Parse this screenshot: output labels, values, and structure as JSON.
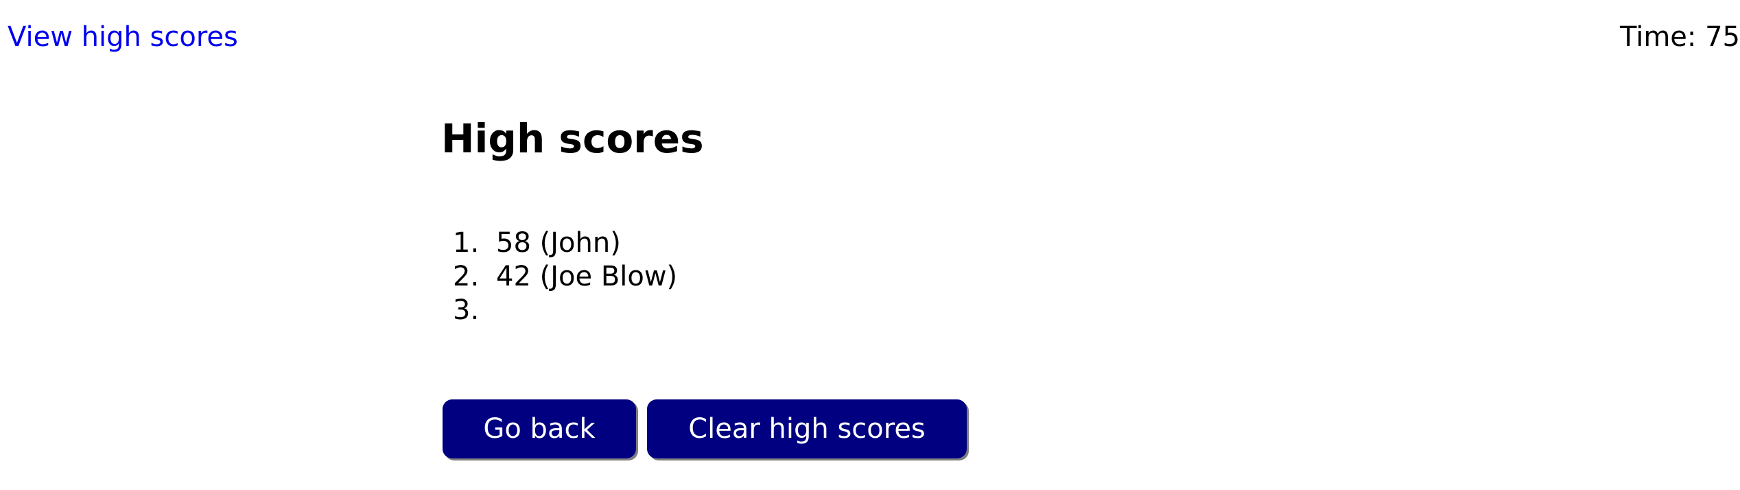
{
  "header": {
    "view_high_scores_link": "View high scores",
    "timer_text": "Time: 75"
  },
  "main": {
    "title": "High scores",
    "scores": [
      {
        "rank": "1.",
        "entry": "58 (John)"
      },
      {
        "rank": "2.",
        "entry": "42 (Joe Blow)"
      },
      {
        "rank": "3.",
        "entry": ""
      }
    ],
    "buttons": {
      "go_back": "Go back",
      "clear_high_scores": "Clear high scores"
    }
  },
  "colors": {
    "link": "#0000ee",
    "button_bg": "#000080",
    "button_text": "#ffffff",
    "button_shadow": "#7f7f7f"
  }
}
